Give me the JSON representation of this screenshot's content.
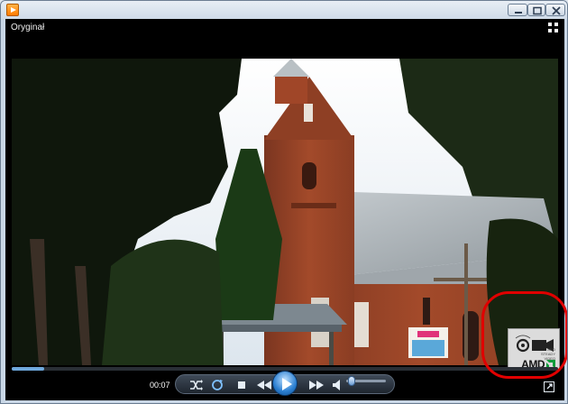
{
  "window": {
    "title": "",
    "buttons": [
      "minimize",
      "maximize",
      "close"
    ]
  },
  "player": {
    "view_label": "Oryginał",
    "time": "00:07",
    "progress_fraction": 0.06,
    "volume_fraction": 0.05
  },
  "badge": {
    "brand": "AMD",
    "subtitle": "AMD STEADY VIDEO"
  },
  "colors": {
    "accent": "#2b7fd1",
    "annotation": "#e00000",
    "player_bg": "#000000"
  },
  "icons": [
    "media-player-icon",
    "layout-switch-icon",
    "shuffle-icon",
    "repeat-icon",
    "stop-icon",
    "previous-icon",
    "play-icon",
    "next-icon",
    "volume-icon",
    "fullscreen-icon",
    "camera-icon"
  ]
}
